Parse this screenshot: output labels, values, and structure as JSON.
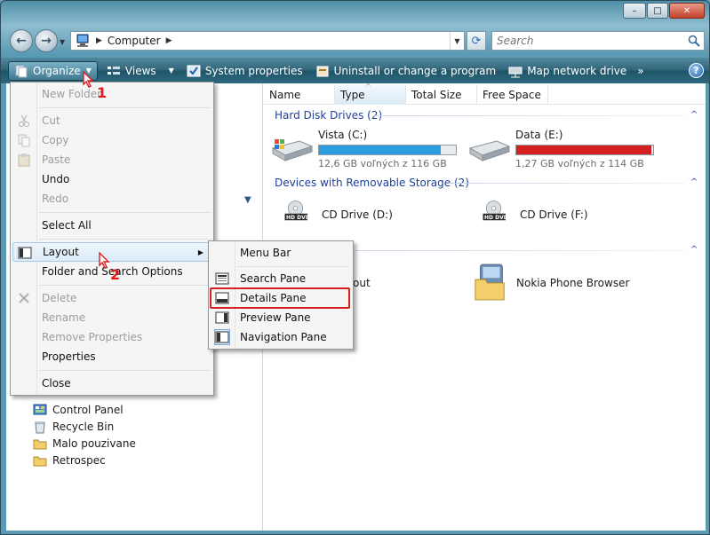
{
  "window": {
    "caption_min": "–",
    "caption_max": "□",
    "caption_close": "✕"
  },
  "address": {
    "location": "Computer",
    "search_placeholder": "Search"
  },
  "toolbar": {
    "organize": "Organize",
    "views": "Views",
    "system_properties": "System properties",
    "uninstall": "Uninstall or change a program",
    "map_network": "Map network drive",
    "more": "»",
    "help": "?"
  },
  "columns": [
    "Name",
    "Type",
    "Total Size",
    "Free Space"
  ],
  "groups": {
    "hdd": "Hard Disk Drives (2)",
    "removable": "Devices with Removable Storage (2)"
  },
  "drives": {
    "c": {
      "name": "Vista (C:)",
      "free": "12,6 GB voľných z 116 GB",
      "used_fraction": 0.89,
      "bar_color": "#2c9ee0"
    },
    "e": {
      "name": "Data (E:)",
      "free": "1,27 GB voľných z 114 GB",
      "used_fraction": 0.99,
      "bar_color": "#d41f1f"
    },
    "d": {
      "name": "CD Drive (D:)",
      "badge": "HD DVD"
    },
    "f": {
      "name": "CD Drive (F:)",
      "badge": "HD DVD"
    }
  },
  "other_items": {
    "partial": "out",
    "nokia": "Nokia Phone Browser"
  },
  "nav_items": [
    {
      "label": "Control Panel",
      "icon": "control-panel-icon"
    },
    {
      "label": "Recycle Bin",
      "icon": "recycle-bin-icon"
    },
    {
      "label": "Malo pouzivane",
      "icon": "folder-icon"
    },
    {
      "label": "Retrospec",
      "icon": "folder-icon"
    }
  ],
  "organize_menu": {
    "new_folder": "New Folder",
    "cut": "Cut",
    "copy": "Copy",
    "paste": "Paste",
    "undo": "Undo",
    "redo": "Redo",
    "select_all": "Select All",
    "layout": "Layout",
    "folder_options": "Folder and Search Options",
    "delete": "Delete",
    "rename": "Rename",
    "remove_properties": "Remove Properties",
    "properties": "Properties",
    "close": "Close"
  },
  "layout_menu": {
    "menu_bar": "Menu Bar",
    "search_pane": "Search Pane",
    "details_pane": "Details Pane",
    "preview_pane": "Preview Pane",
    "navigation_pane": "Navigation Pane"
  },
  "annotations": {
    "step1": "1",
    "step2": "2"
  },
  "colors": {
    "annotation_red": "#d81e1e",
    "group_header_blue": "#1e3f9a",
    "toolbar_dark": "#1f5468"
  }
}
